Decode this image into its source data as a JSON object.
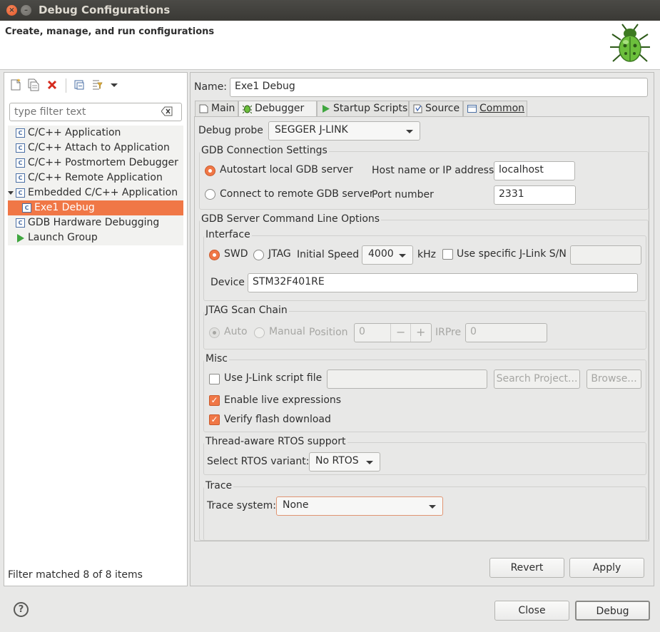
{
  "window": {
    "title": "Debug Configurations",
    "close_glyph": "×",
    "min_glyph": "–"
  },
  "header": {
    "text": "Create, manage, and run configurations",
    "icon": "bug-icon"
  },
  "left": {
    "filter_placeholder": "type filter text",
    "tree": [
      {
        "label": "C/C++ Application",
        "icon": "c-config-icon"
      },
      {
        "label": "C/C++ Attach to Application",
        "icon": "c-config-icon"
      },
      {
        "label": "C/C++ Postmortem Debugger",
        "icon": "c-config-icon"
      },
      {
        "label": "C/C++ Remote Application",
        "icon": "c-config-icon"
      },
      {
        "label": "Embedded C/C++ Application",
        "icon": "c-config-icon",
        "expanded": true
      },
      {
        "label": "Exe1 Debug",
        "icon": "c-config-icon",
        "selected": true
      },
      {
        "label": "GDB Hardware Debugging",
        "icon": "c-config-icon"
      },
      {
        "label": "Launch Group",
        "icon": "launch-icon"
      }
    ],
    "status": "Filter matched 8 of 8 items"
  },
  "right": {
    "name_label": "Name:",
    "name_value": "Exe1 Debug",
    "tabs": [
      {
        "label": "Main"
      },
      {
        "label": "Debugger",
        "active": true
      },
      {
        "label": "Startup Scripts"
      },
      {
        "label": "Source"
      },
      {
        "label": "Common"
      }
    ],
    "debug_probe_label": "Debug probe",
    "debug_probe_value": "SEGGER J-LINK",
    "gdb_conn": {
      "title": "GDB Connection Settings",
      "autostart": "Autostart local GDB server",
      "connect_remote": "Connect to remote GDB server",
      "host_label": "Host name or IP address",
      "host_value": "localhost",
      "port_label": "Port number",
      "port_value": "2331"
    },
    "gdb_server": {
      "title": "GDB Server Command Line Options",
      "interface": {
        "title": "Interface",
        "swd": "SWD",
        "jtag": "JTAG",
        "initial_speed_label": "Initial Speed",
        "initial_speed_value": "4000",
        "khz": "kHz",
        "use_sn": "Use specific J-Link S/N",
        "sn_value": "",
        "device_label": "Device",
        "device_value": "STM32F401RE"
      },
      "jtag_chain": {
        "title": "JTAG Scan Chain",
        "auto": "Auto",
        "manual": "Manual",
        "position_label": "Position",
        "position_value": "0",
        "minus": "−",
        "plus": "+",
        "irpre_label": "IRPre",
        "irpre_value": "0"
      },
      "misc": {
        "title": "Misc",
        "use_script": "Use J-Link script file",
        "script_value": "",
        "search_project": "Search Project...",
        "browse": "Browse...",
        "enable_live": "Enable live expressions",
        "verify_flash": "Verify flash download",
        "check_glyph": "✓"
      },
      "rtos": {
        "title": "Thread-aware RTOS support",
        "select_label": "Select RTOS variant:",
        "value": "No RTOS"
      },
      "trace": {
        "title": "Trace",
        "label": "Trace system:",
        "value": "None"
      }
    },
    "revert": "Revert",
    "apply": "Apply"
  },
  "footer": {
    "help_glyph": "?",
    "close": "Close",
    "debug": "Debug"
  },
  "colors": {
    "accent": "#f07746",
    "title_bar": "#3c3b37",
    "bug_green": "#5aa832"
  }
}
